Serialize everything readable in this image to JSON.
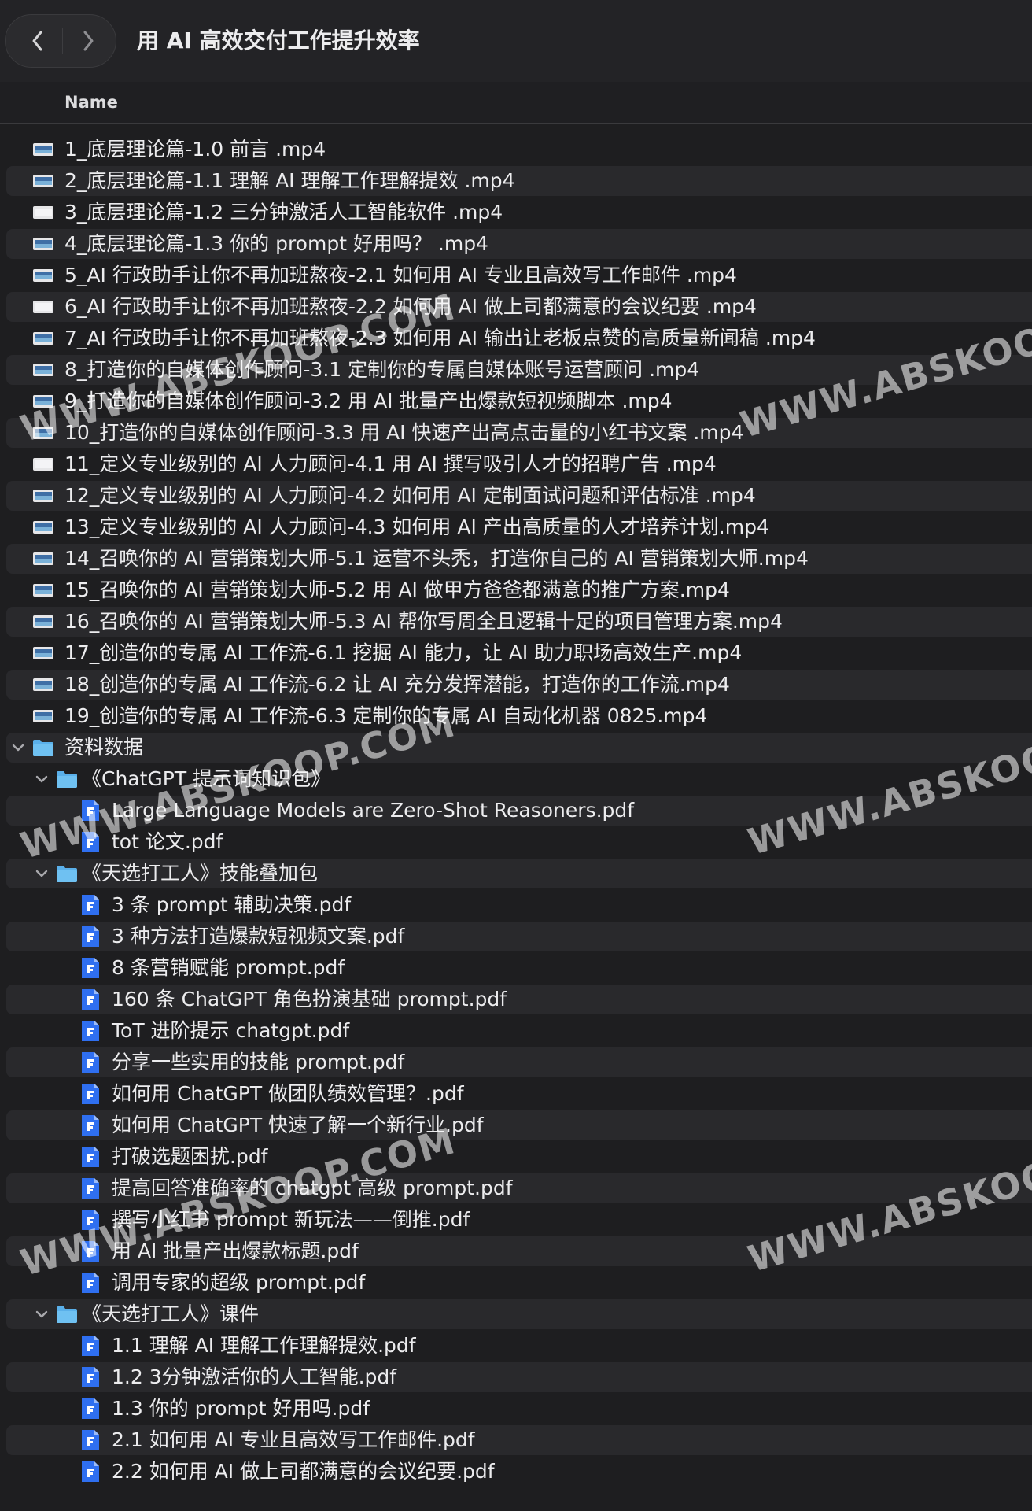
{
  "window": {
    "title": "用 AI 高效交付工作提升效率"
  },
  "columns": {
    "name": "Name"
  },
  "watermark": {
    "text": "WWW.ABSKOOP.COM",
    "text_cut": "WWW.ABSKOOP.CO"
  },
  "colors": {
    "background": "#1e1e20",
    "row_alt": "#29292c",
    "folder": "#5ab0ea",
    "pdf_icon": "#2f6ff0"
  },
  "rows": [
    {
      "label": "1_底层理论篇-1.0 前言 .mp4",
      "kind": "video",
      "level": 0
    },
    {
      "label": "2_底层理论篇-1.1 理解 AI 理解工作理解提效 .mp4",
      "kind": "video",
      "level": 0
    },
    {
      "label": "3_底层理论篇-1.2 三分钟激活人工智能软件 .mp4",
      "kind": "video-white",
      "level": 0
    },
    {
      "label": "4_底层理论篇-1.3 你的 prompt 好用吗？ .mp4",
      "kind": "video",
      "level": 0
    },
    {
      "label": "5_AI 行政助手让你不再加班熬夜-2.1 如何用 AI 专业且高效写工作邮件 .mp4",
      "kind": "video",
      "level": 0
    },
    {
      "label": "6_AI 行政助手让你不再加班熬夜-2.2 如何用 AI 做上司都满意的会议纪要 .mp4",
      "kind": "video-white",
      "level": 0
    },
    {
      "label": "7_AI 行政助手让你不再加班熬夜-2.3 如何用 AI 输出让老板点赞的高质量新闻稿 .mp4",
      "kind": "video",
      "level": 0
    },
    {
      "label": "8_打造你的自媒体创作顾问-3.1 定制你的专属自媒体账号运营顾问 .mp4",
      "kind": "video",
      "level": 0
    },
    {
      "label": "9_打造你的自媒体创作顾问-3.2 用 AI 批量产出爆款短视频脚本 .mp4",
      "kind": "video",
      "level": 0
    },
    {
      "label": "10_打造你的自媒体创作顾问-3.3 用 AI 快速产出高点击量的小红书文案 .mp4",
      "kind": "video",
      "level": 0
    },
    {
      "label": "11_定义专业级别的 AI 人力顾问-4.1 用 AI 撰写吸引人才的招聘广告 .mp4",
      "kind": "video-white",
      "level": 0
    },
    {
      "label": "12_定义专业级别的 AI 人力顾问-4.2 如何用 AI 定制面试问题和评估标准 .mp4",
      "kind": "video",
      "level": 0
    },
    {
      "label": "13_定义专业级别的 AI 人力顾问-4.3 如何用 AI 产出高质量的人才培养计划.mp4",
      "kind": "video",
      "level": 0
    },
    {
      "label": "14_召唤你的 AI 营销策划大师-5.1 运营不头秃，打造你自己的 AI 营销策划大师.mp4",
      "kind": "video",
      "level": 0
    },
    {
      "label": "15_召唤你的 AI 营销策划大师-5.2 用 AI 做甲方爸爸都满意的推广方案.mp4",
      "kind": "video",
      "level": 0
    },
    {
      "label": "16_召唤你的 AI 营销策划大师-5.3 AI 帮你写周全且逻辑十足的项目管理方案.mp4",
      "kind": "video",
      "level": 0
    },
    {
      "label": "17_创造你的专属 AI 工作流-6.1 挖掘 AI 能力，让 AI 助力职场高效生产.mp4",
      "kind": "video",
      "level": 0
    },
    {
      "label": "18_创造你的专属 AI 工作流-6.2 让 AI 充分发挥潜能，打造你的工作流.mp4",
      "kind": "video",
      "level": 0
    },
    {
      "label": "19_创造你的专属 AI 工作流-6.3 定制你的专属 AI 自动化机器 0825.mp4",
      "kind": "video",
      "level": 0
    },
    {
      "label": "资料数据",
      "kind": "folder",
      "level": 0,
      "expanded": true
    },
    {
      "label": "《ChatGPT 提示词知识包》",
      "kind": "folder",
      "level": 1,
      "expanded": true
    },
    {
      "label": "Large Language Models are Zero-Shot Reasoners.pdf",
      "kind": "pdf",
      "level": 2
    },
    {
      "label": "tot 论文.pdf",
      "kind": "pdf",
      "level": 2
    },
    {
      "label": "《天选打工人》技能叠加包",
      "kind": "folder",
      "level": 1,
      "expanded": true
    },
    {
      "label": "3 条 prompt 辅助决策.pdf",
      "kind": "pdf",
      "level": 2
    },
    {
      "label": "3 种方法打造爆款短视频文案.pdf",
      "kind": "pdf",
      "level": 2
    },
    {
      "label": "8 条营销赋能 prompt.pdf",
      "kind": "pdf",
      "level": 2
    },
    {
      "label": "160 条 ChatGPT 角色扮演基础 prompt.pdf",
      "kind": "pdf",
      "level": 2
    },
    {
      "label": "ToT 进阶提示 chatgpt.pdf",
      "kind": "pdf",
      "level": 2
    },
    {
      "label": "分享一些实用的技能 prompt.pdf",
      "kind": "pdf",
      "level": 2
    },
    {
      "label": "如何用 ChatGPT 做团队绩效管理？.pdf",
      "kind": "pdf",
      "level": 2
    },
    {
      "label": "如何用 ChatGPT 快速了解一个新行业.pdf",
      "kind": "pdf",
      "level": 2
    },
    {
      "label": "打破选题困扰.pdf",
      "kind": "pdf",
      "level": 2
    },
    {
      "label": "提高回答准确率的 chatgpt 高级 prompt.pdf",
      "kind": "pdf",
      "level": 2
    },
    {
      "label": "撰写小红书 prompt 新玩法——倒推.pdf",
      "kind": "pdf",
      "level": 2
    },
    {
      "label": "用 AI 批量产出爆款标题.pdf",
      "kind": "pdf",
      "level": 2
    },
    {
      "label": "调用专家的超级 prompt.pdf",
      "kind": "pdf",
      "level": 2
    },
    {
      "label": "《天选打工人》课件",
      "kind": "folder",
      "level": 1,
      "expanded": true
    },
    {
      "label": "1.1 理解 AI 理解工作理解提效.pdf",
      "kind": "pdf",
      "level": 2
    },
    {
      "label": "1.2 3分钟激活你的人工智能.pdf",
      "kind": "pdf",
      "level": 2
    },
    {
      "label": "1.3 你的 prompt 好用吗.pdf",
      "kind": "pdf",
      "level": 2
    },
    {
      "label": "2.1 如何用 AI 专业且高效写工作邮件.pdf",
      "kind": "pdf",
      "level": 2
    },
    {
      "label": "2.2 如何用 AI 做上司都满意的会议纪要.pdf",
      "kind": "pdf",
      "level": 2
    }
  ]
}
